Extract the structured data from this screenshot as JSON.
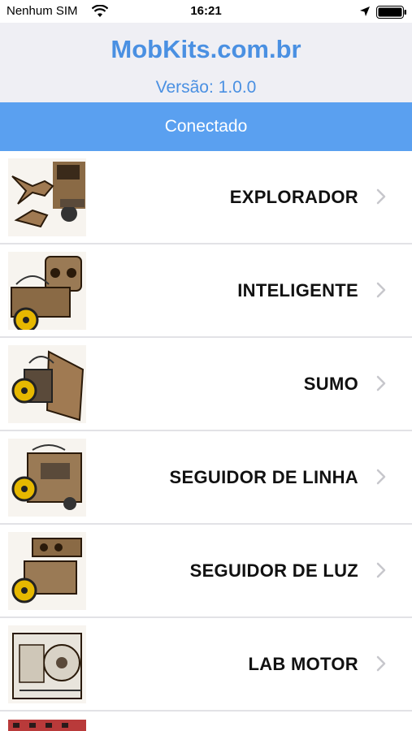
{
  "status_bar": {
    "carrier": "Nenhum SIM",
    "time": "16:21"
  },
  "header": {
    "title": "MobKits.com.br",
    "version": "Versão: 1.0.0"
  },
  "connection": {
    "status": "Conectado"
  },
  "kits": [
    {
      "label": "EXPLORADOR",
      "image": "explorer-robot-image"
    },
    {
      "label": "INTELIGENTE",
      "image": "smart-robot-image"
    },
    {
      "label": "SUMO",
      "image": "sumo-robot-image"
    },
    {
      "label": "SEGUIDOR DE LINHA",
      "image": "line-follower-robot-image"
    },
    {
      "label": "SEGUIDOR DE LUZ",
      "image": "light-follower-robot-image"
    },
    {
      "label": "LAB MOTOR",
      "image": "motor-lab-image"
    }
  ],
  "colors": {
    "accent": "#4a90e2",
    "banner": "#5aa0f0",
    "header_bg": "#efeff4",
    "chevron": "#c7c7cc"
  }
}
